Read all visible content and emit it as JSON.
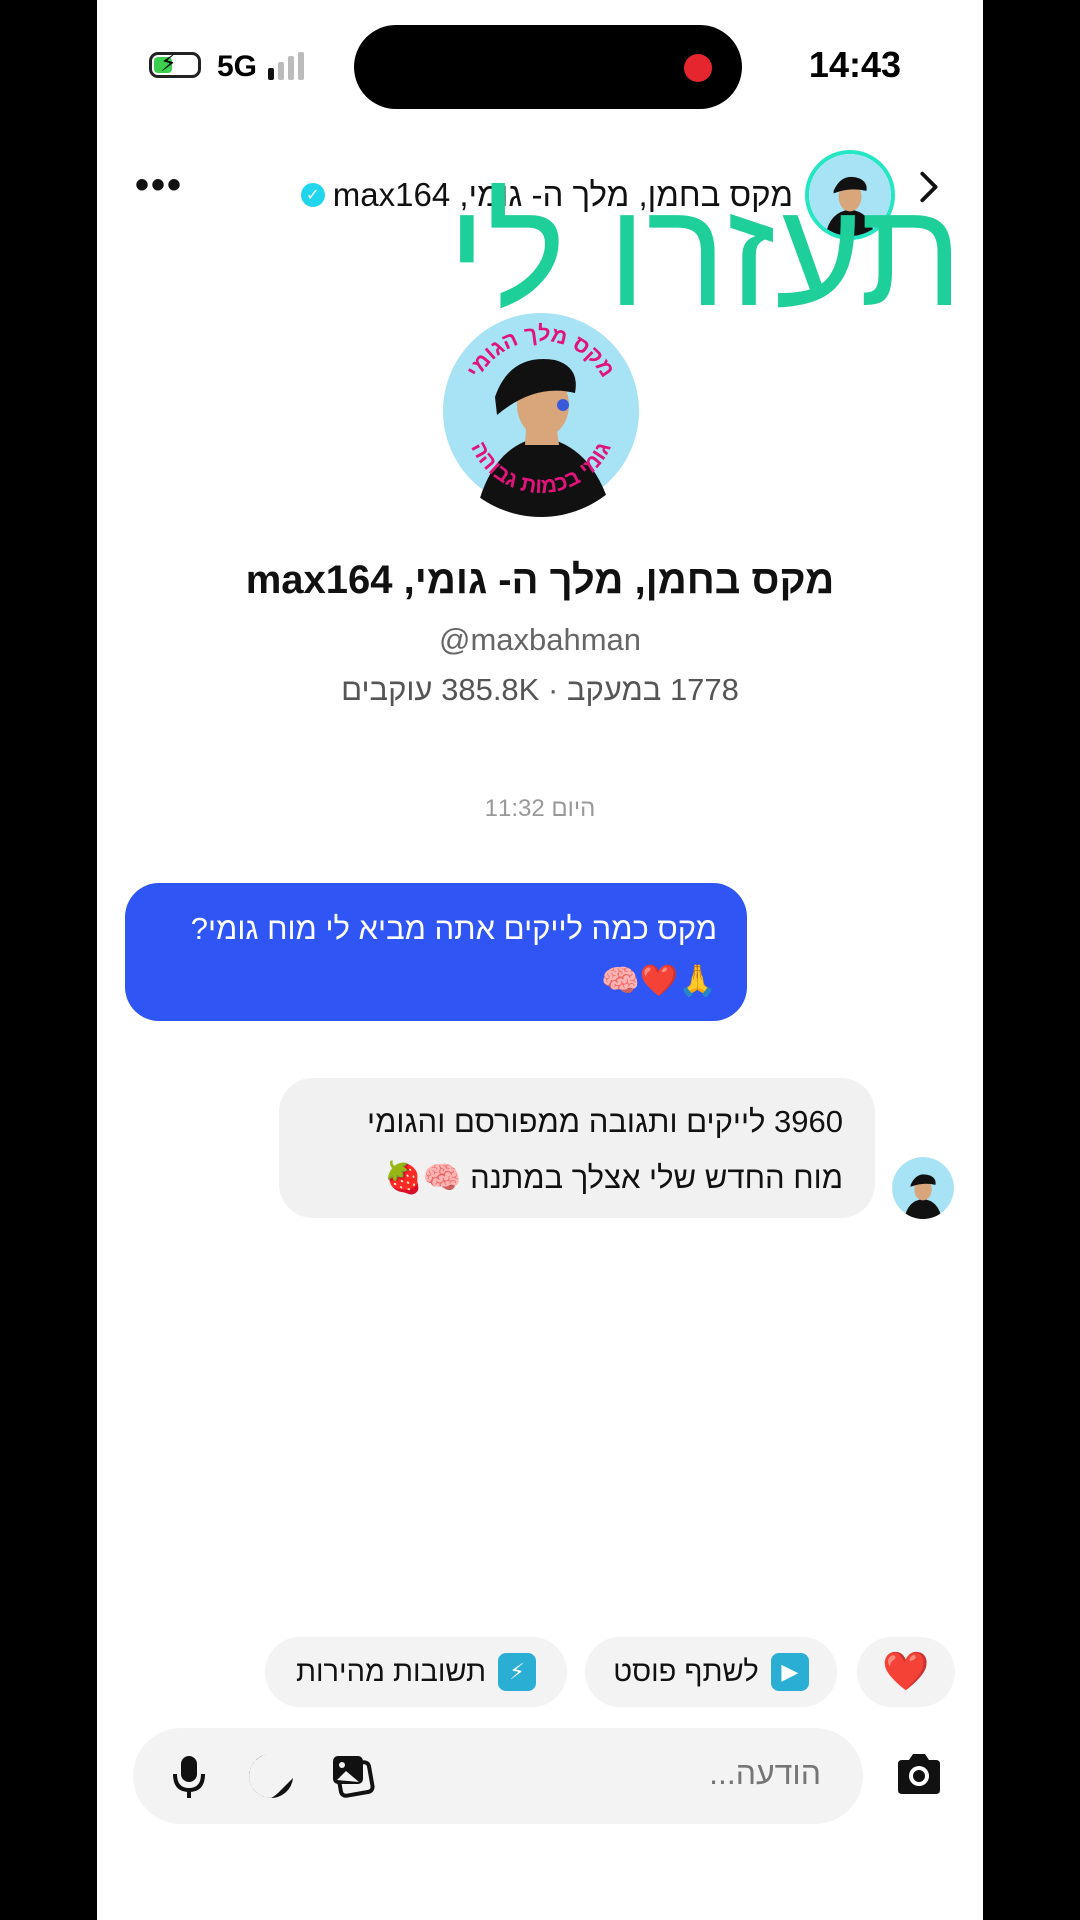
{
  "status_bar": {
    "time": "14:43",
    "network": "5G"
  },
  "header": {
    "name": "מקס בחמן, מלך ה- גומי, max164",
    "more_icon": "more-dots-icon",
    "back_icon": "chevron-right-icon"
  },
  "overlay": {
    "text": "תעזרו לי"
  },
  "profile": {
    "name": "מקס בחמן, מלך ה- גומי, max164",
    "handle": "@maxbahman",
    "stats": "1778 במעקב · 385.8K עוקבים",
    "avatar_text_top": "מקס מלך הגומי",
    "avatar_text_bottom": "גומי בכמות גבוהה"
  },
  "chat": {
    "timestamp": "היום 11:32",
    "messages": [
      {
        "direction": "outgoing",
        "line1": "מקס כמה לייקים אתה מביא לי מוח גומי?",
        "line2": "🙏❤️🧠"
      },
      {
        "direction": "incoming",
        "line1": "3960 לייקים ותגובה ממפורסם והגומי",
        "line2": "מוח החדש שלי אצלך במתנה 🧠🍓"
      }
    ]
  },
  "quick_actions": {
    "heart": "❤️",
    "share_post": "לשתף פוסט",
    "quick_replies": "תשובות מהירות"
  },
  "composer": {
    "placeholder": "הודעה..."
  },
  "colors": {
    "accent_blue": "#2f55f4",
    "overlay_green": "#1fcf9a",
    "verified": "#20d5ec"
  }
}
